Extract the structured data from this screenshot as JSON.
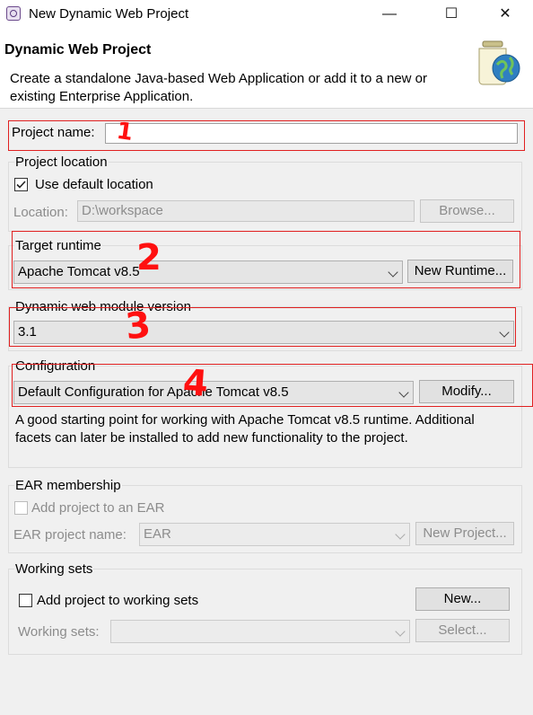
{
  "window": {
    "title": "New Dynamic Web Project",
    "minimize": "—",
    "maximize": "☐",
    "close": "✕"
  },
  "header": {
    "title": "Dynamic Web Project",
    "description": "Create a standalone Java-based Web Application or add it to a new or existing Enterprise Application."
  },
  "project_name": {
    "label": "Project name:",
    "value": ""
  },
  "project_location": {
    "group_label": "Project location",
    "use_default_label": "Use default location",
    "use_default_checked": true,
    "location_label": "Location:",
    "location_value": "D:\\workspace",
    "browse_label": "Browse..."
  },
  "target_runtime": {
    "group_label": "Target runtime",
    "selected": "Apache Tomcat v8.5",
    "new_runtime_label": "New Runtime..."
  },
  "web_module": {
    "group_label": "Dynamic web module version",
    "selected": "3.1"
  },
  "configuration": {
    "group_label": "Configuration",
    "selected": "Default Configuration for Apache Tomcat v8.5",
    "modify_label": "Modify...",
    "description": "A good starting point for working with Apache Tomcat v8.5 runtime. Additional facets can later be installed to add new functionality to the project."
  },
  "ear": {
    "group_label": "EAR membership",
    "add_label": "Add project to an EAR",
    "project_name_label": "EAR project name:",
    "project_name_value": "EAR",
    "new_project_label": "New Project..."
  },
  "working_sets": {
    "group_label": "Working sets",
    "add_label": "Add project to working sets",
    "new_label": "New...",
    "sets_label": "Working sets:",
    "sets_value": "",
    "select_label": "Select..."
  },
  "annotations": {
    "n1": "1",
    "n2": "2",
    "n3": "3",
    "n4": "4"
  },
  "colors": {
    "annotation": "#e02020",
    "dialog_bg": "#f0f0f0"
  }
}
